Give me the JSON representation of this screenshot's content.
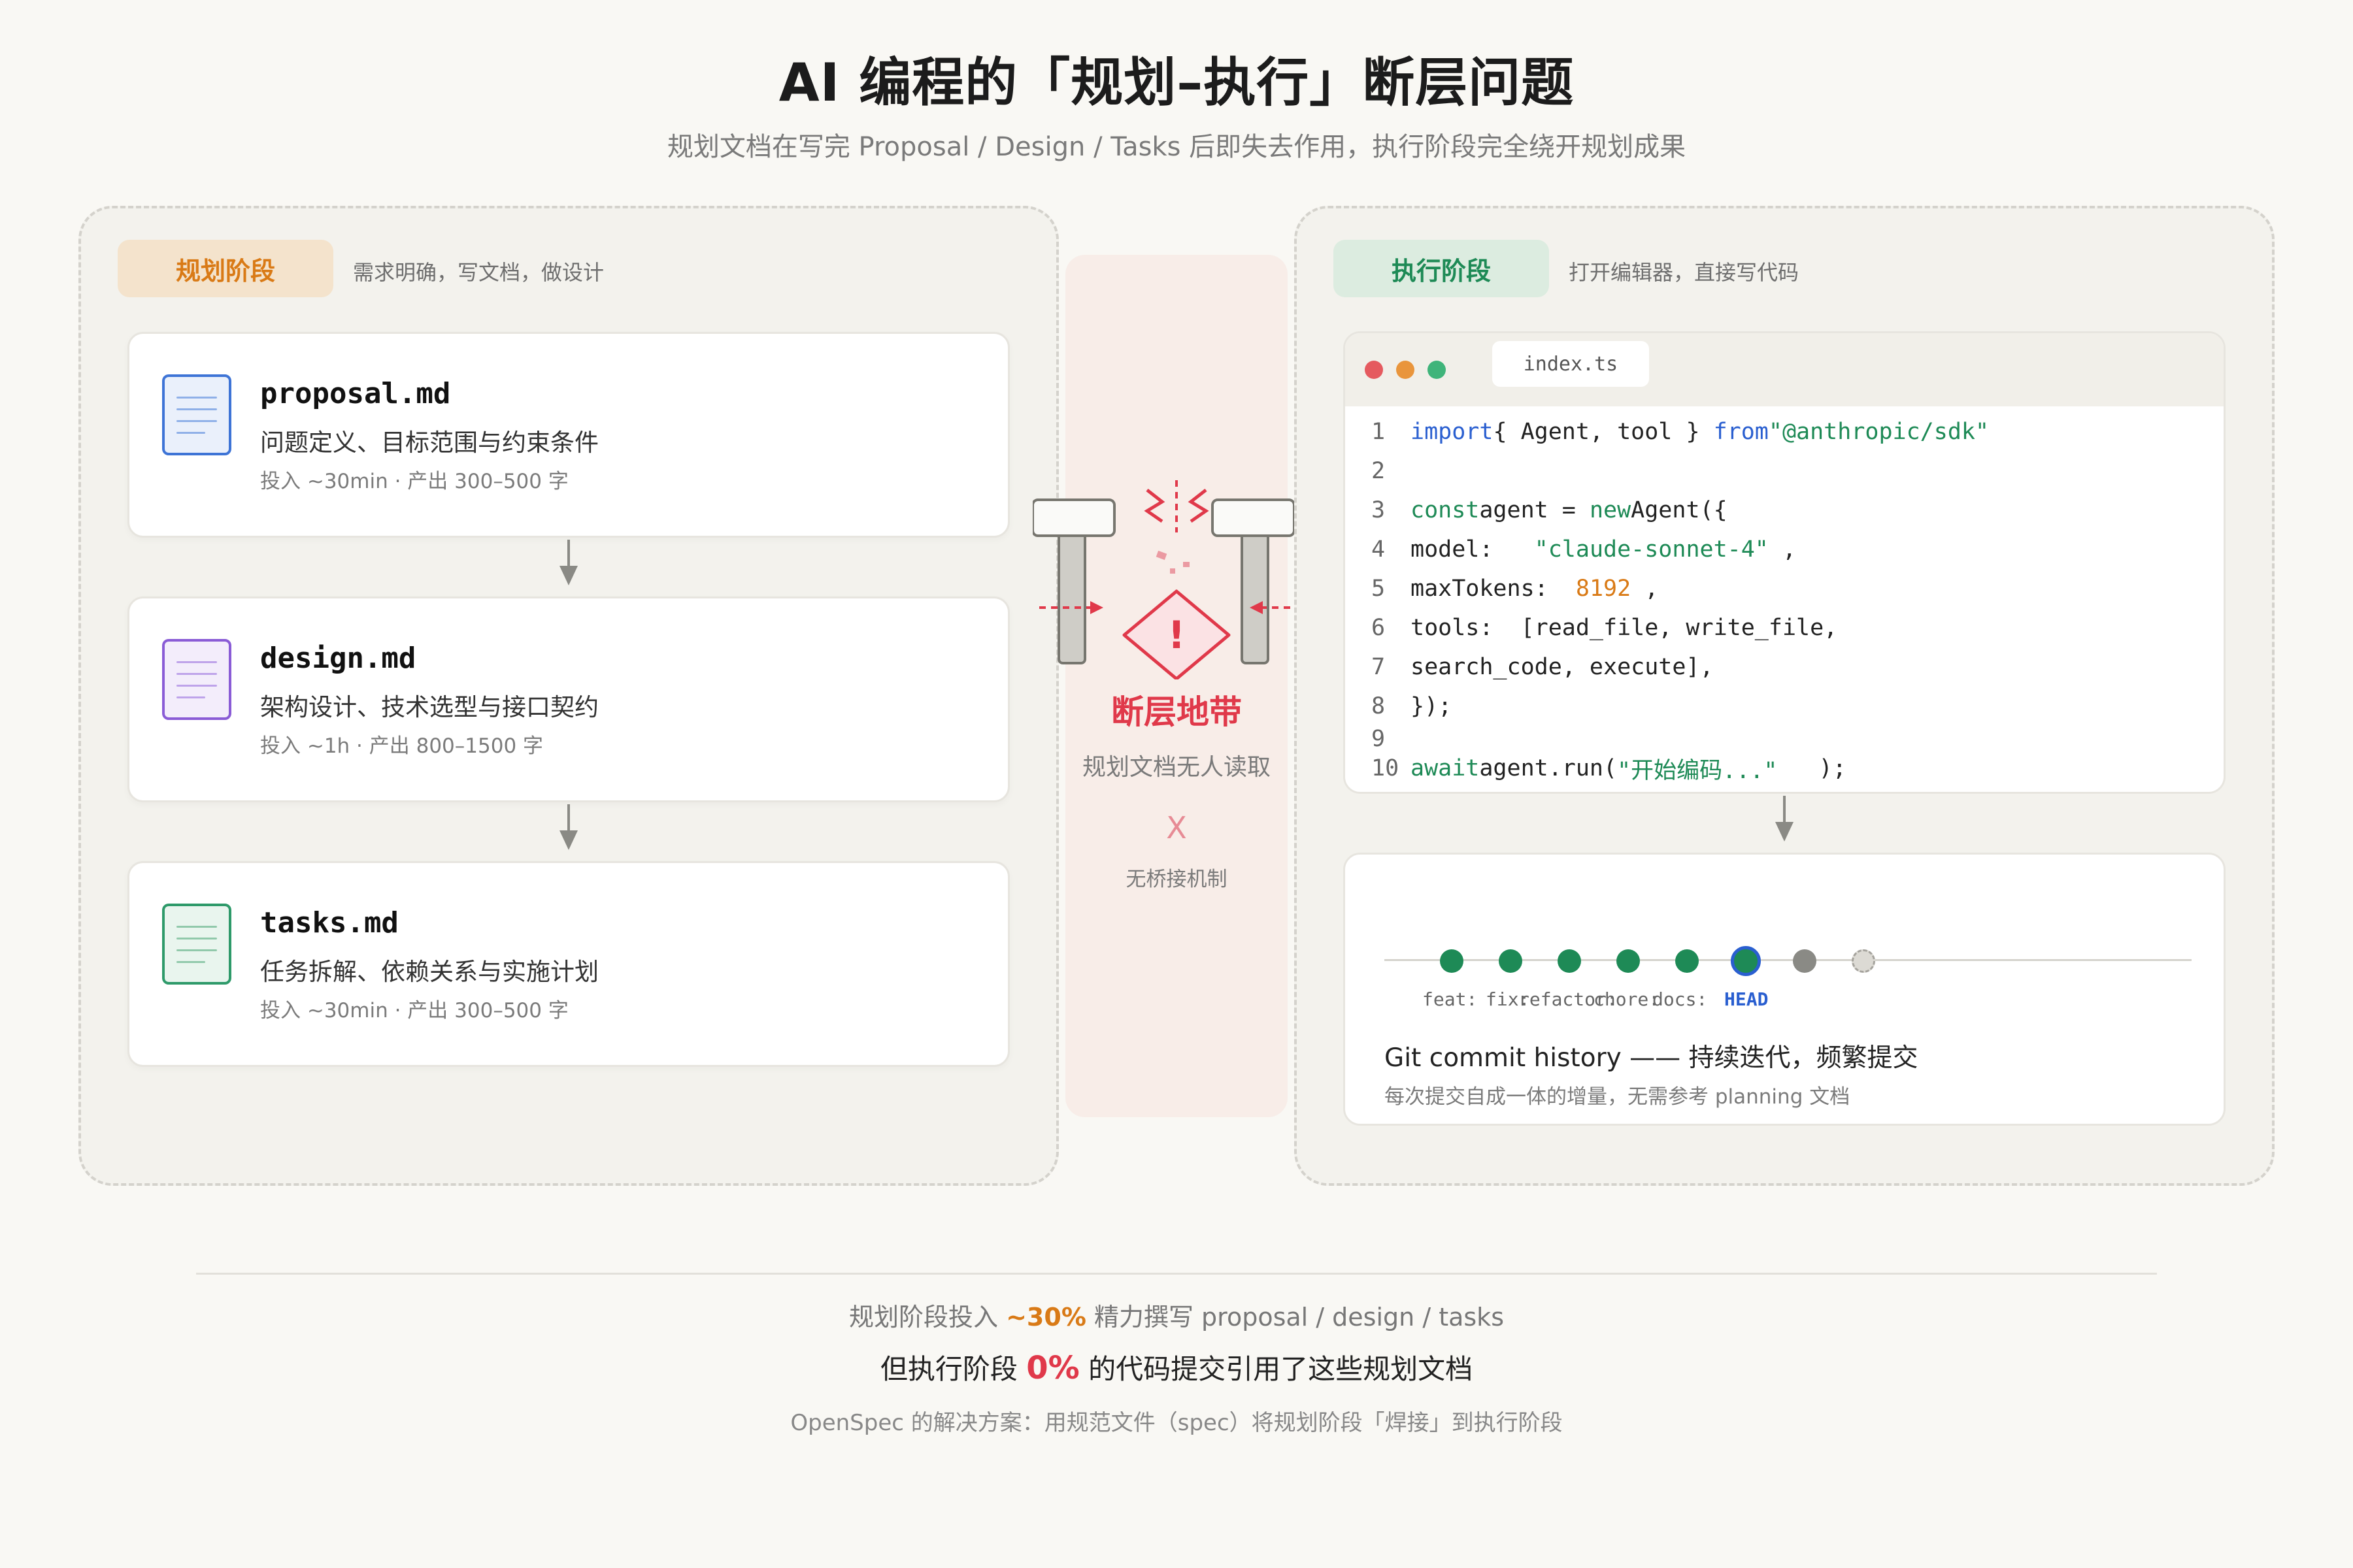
{
  "header": {
    "title": "AI 编程的「规划–执行」断层问题",
    "subtitle": "规划文档在写完 Proposal / Design / Tasks 后即失去作用，执行阶段完全绕开规划成果"
  },
  "planning": {
    "chip": "规划阶段",
    "chip_desc": "需求明确，写文档，做设计",
    "docs": [
      {
        "name": "proposal.md",
        "desc": "问题定义、目标范围与约束条件",
        "meta": "投入 ~30min · 产出 300–500 字",
        "icon": "document-icon",
        "color": "#3e74d6"
      },
      {
        "name": "design.md",
        "desc": "架构设计、技术选型与接口契约",
        "meta": "投入 ~1h · 产出 800–1500 字",
        "icon": "document-icon",
        "color": "#8a5cd6"
      },
      {
        "name": "tasks.md",
        "desc": "任务拆解、依赖关系与实施计划",
        "meta": "投入 ~30min · 产出 300–500 字",
        "icon": "document-icon",
        "color": "#2e9a6a"
      }
    ]
  },
  "gap": {
    "icon": "warning-icon",
    "mark": "!",
    "title": "断层地带",
    "subtitle": "规划文档无人读取",
    "x": "X",
    "note": "无桥接机制"
  },
  "execution": {
    "chip": "执行阶段",
    "chip_desc": "打开编辑器，直接写代码",
    "editor": {
      "tab": "index.ts",
      "lines": {
        "l1_no": "1",
        "l1_a": "import",
        "l1_b": "{ Agent, tool } ",
        "l1_c": "from",
        "l1_d": "\"@anthropic/sdk\"",
        "l2_no": "2",
        "l3_no": "3",
        "l3_a": "const",
        "l3_b": "agent = ",
        "l3_c": "new",
        "l3_d": "Agent({",
        "l4_no": "4",
        "l4_a": "model:   ",
        "l4_b": "\"claude-sonnet-4\"",
        "l4_c": " ,",
        "l5_no": "5",
        "l5_a": "maxTokens:  ",
        "l5_b": "8192",
        "l5_c": " ,",
        "l6_no": "6",
        "l6_a": "tools:  [read_file, write_file,",
        "l7_no": "7",
        "l7_a": "search_code, execute],",
        "l8_no": "8",
        "l8_a": "});",
        "l9_no": "9",
        "l10_no": "10",
        "l10_a": "await",
        "l10_b": "agent.run(",
        "l10_c": "\"开始编码...\"",
        "l10_d": "   );"
      }
    },
    "git": {
      "labels": [
        "feat:",
        "fix:",
        "refactor:",
        "chore:",
        "docs:",
        "HEAD"
      ],
      "title": "Git commit history —— 持续迭代，频繁提交",
      "subtitle": "每次提交自成一体的增量，无需参考 planning 文档"
    }
  },
  "footer": {
    "line1_a": "规划阶段投入 ",
    "line1_b": "~30%",
    "line1_c": " 精力撰写 proposal / design / tasks",
    "line2_a": "但执行阶段 ",
    "line2_b": "0%",
    "line2_c": " 的代码提交引用了这些规划文档",
    "line3": "OpenSpec 的解决方案：用规范文件（spec）将规划阶段「焊接」到执行阶段"
  },
  "colors": {
    "accent_orange": "#d97a16",
    "accent_green": "#1e8a56",
    "accent_red": "#e0394a",
    "head_blue": "#2a5fd0"
  }
}
